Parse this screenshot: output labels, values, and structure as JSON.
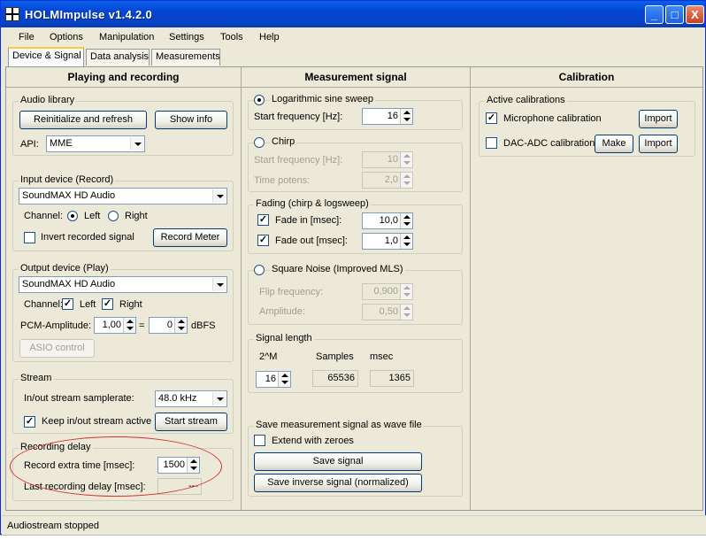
{
  "window": {
    "title": "HOLMImpulse  v1.4.2.0",
    "controls": [
      "_",
      "□",
      "X"
    ]
  },
  "menu": [
    "File",
    "Options",
    "Manipulation",
    "Settings",
    "Tools",
    "Help"
  ],
  "tabs": [
    "Device & Signal",
    "Data analysis",
    "Measurements"
  ],
  "playing": {
    "header": "Playing and recording",
    "audio_library": {
      "title": "Audio library",
      "reinit_button": "Reinitialize and refresh",
      "show_info_button": "Show info",
      "api_label": "API:",
      "api_value": "MME"
    },
    "input_device": {
      "title": "Input device (Record)",
      "device": "SoundMAX HD Audio",
      "channel_label": "Channel:",
      "left": "Left",
      "right": "Right",
      "invert_label": "Invert recorded signal",
      "record_meter_button": "Record Meter"
    },
    "output_device": {
      "title": "Output device (Play)",
      "device": "SoundMAX HD Audio",
      "channel_label": "Channel:",
      "left": "Left",
      "right": "Right",
      "pcm_label": "PCM-Amplitude:",
      "pcm_value": "1,00",
      "equals": "=",
      "dbfs_value": "0",
      "dbfs_unit": "dBFS",
      "asio_button": "ASIO control"
    },
    "stream": {
      "title": "Stream",
      "samplerate_label": "In/out stream samplerate:",
      "samplerate_value": "48.0 kHz",
      "keep_active_label": "Keep in/out stream active",
      "start_stream_button": "Start stream"
    },
    "recording_delay": {
      "title": "Recording delay",
      "extra_time_label": "Record extra time [msec]:",
      "extra_time_value": "1500",
      "last_delay_label": "Last recording delay [msec]:",
      "last_delay_value": "---"
    }
  },
  "measurement": {
    "header": "Measurement signal",
    "log_sweep": {
      "title": "Logarithmic sine sweep",
      "start_freq_label": "Start frequency [Hz]:",
      "start_freq_value": "16"
    },
    "chirp": {
      "title": "Chirp",
      "start_freq_label": "Start frequency [Hz]:",
      "start_freq_value": "10",
      "time_potens_label": "Time potens:",
      "time_potens_value": "2,0"
    },
    "fading": {
      "title": "Fading (chirp & logsweep)",
      "fade_in_label": "Fade in [msec]:",
      "fade_in_value": "10,0",
      "fade_out_label": "Fade out [msec]:",
      "fade_out_value": "1,0"
    },
    "square_noise": {
      "title": "Square Noise (Improved MLS)",
      "flip_label": "Flip frequency:",
      "flip_value": "0,900",
      "amplitude_label": "Amplitude:",
      "amplitude_value": "0,50"
    },
    "signal_length": {
      "title": "Signal length",
      "col_m": "2^M",
      "col_samples": "Samples",
      "col_msec": "msec",
      "m_value": "16",
      "samples_value": "65536",
      "msec_value": "1365"
    },
    "save": {
      "title": "Save measurement signal as wave file",
      "extend_label": "Extend with zeroes",
      "save_button": "Save signal",
      "save_inverse_button": "Save inverse signal (normalized)"
    }
  },
  "calibration": {
    "header": "Calibration",
    "active_title": "Active calibrations",
    "mic_label": "Microphone calibration",
    "import_label": "Import",
    "dac_label": "DAC-ADC calibration",
    "make_label": "Make"
  },
  "status": "Audiostream stopped",
  "colors": {
    "titlebar": "#0545d4",
    "annotation_ellipse": "#d63030",
    "tab_highlight": "#ffc83c"
  }
}
